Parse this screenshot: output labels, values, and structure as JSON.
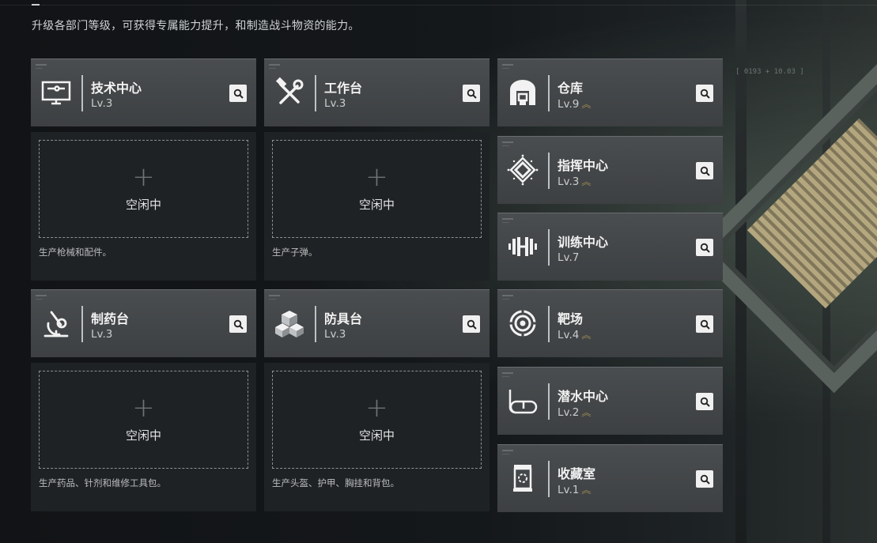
{
  "description": "升级各部门等级，可获得专属能力提升，和制造战斗物资的能力。",
  "background_coords": "[ 0193 + 10.03 ]",
  "colors": {
    "card_bg": "#45484a",
    "panel_bg": "#1f2225",
    "upgrade_chevron": "#9c8a55",
    "search_button": "#f0f0f0"
  },
  "production_units": [
    {
      "name": "技术中心",
      "level": "Lv.3",
      "icon": "computer-terminal-icon",
      "slot_plus": "+",
      "slot_status": "空闲中",
      "note": "生产枪械和配件。"
    },
    {
      "name": "工作台",
      "level": "Lv.3",
      "icon": "wrench-hammer-icon",
      "slot_plus": "+",
      "slot_status": "空闲中",
      "note": "生产子弹。"
    },
    {
      "name": "制药台",
      "level": "Lv.3",
      "icon": "microscope-icon",
      "slot_plus": "+",
      "slot_status": "空闲中",
      "note": "生产药品、针剂和维修工具包。"
    },
    {
      "name": "防具台",
      "level": "Lv.3",
      "icon": "armor-cubes-icon",
      "slot_plus": "+",
      "slot_status": "空闲中",
      "note": "生产头盔、护甲、胸挂和背包。"
    }
  ],
  "facilities": [
    {
      "name": "仓库",
      "level": "Lv.9",
      "upgradable": true,
      "upgrade_glyph": "︽",
      "icon": "warehouse-icon"
    },
    {
      "name": "指挥中心",
      "level": "Lv.3",
      "upgradable": true,
      "upgrade_glyph": "︽",
      "icon": "command-diamond-icon"
    },
    {
      "name": "训练中心",
      "level": "Lv.7",
      "upgradable": false,
      "upgrade_glyph": "",
      "icon": "dumbbell-icon"
    },
    {
      "name": "靶场",
      "level": "Lv.4",
      "upgradable": true,
      "upgrade_glyph": "︽",
      "icon": "target-icon"
    },
    {
      "name": "潜水中心",
      "level": "Lv.2",
      "upgradable": true,
      "upgrade_glyph": "︽",
      "icon": "diving-mask-icon"
    },
    {
      "name": "收藏室",
      "level": "Lv.1",
      "upgradable": true,
      "upgrade_glyph": "︽",
      "icon": "collection-case-icon"
    }
  ]
}
